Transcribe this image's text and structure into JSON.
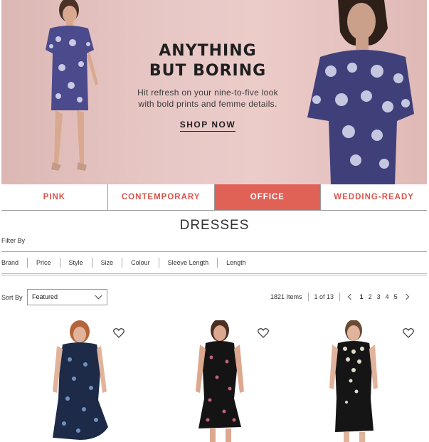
{
  "hero": {
    "title": "ANYTHING\nBUT BORING",
    "subtitle": "Hit refresh on your nine-to-five look\nwith bold prints and femme details.",
    "cta": "SHOP NOW"
  },
  "tabs": [
    {
      "label": "PINK",
      "active": false
    },
    {
      "label": "CONTEMPORARY",
      "active": false
    },
    {
      "label": "OFFICE",
      "active": true
    },
    {
      "label": "WEDDING-READY",
      "active": false
    }
  ],
  "page_title": "DRESSES",
  "filter_by_label": "Filter By",
  "filters": [
    "Brand",
    "Price",
    "Style",
    "Size",
    "Colour",
    "Sleeve Length",
    "Length"
  ],
  "sort": {
    "label": "Sort By",
    "selected": "Featured"
  },
  "results": {
    "items_count": "1821 Items",
    "page_of": "1 of 13",
    "pages": [
      "1",
      "2",
      "3",
      "4",
      "5"
    ],
    "current_page": "1"
  },
  "products": [
    {
      "icon": "heart-icon",
      "dress": "navy floral wrap midi dress"
    },
    {
      "icon": "heart-icon",
      "dress": "black floral sleeveless midi dress"
    },
    {
      "icon": "heart-icon",
      "dress": "black and white print cap-sleeve sheath dress"
    }
  ],
  "colors": {
    "accent": "#e06156",
    "accent_text": "#d8544a",
    "hero_bg": "#e8c8c6"
  }
}
